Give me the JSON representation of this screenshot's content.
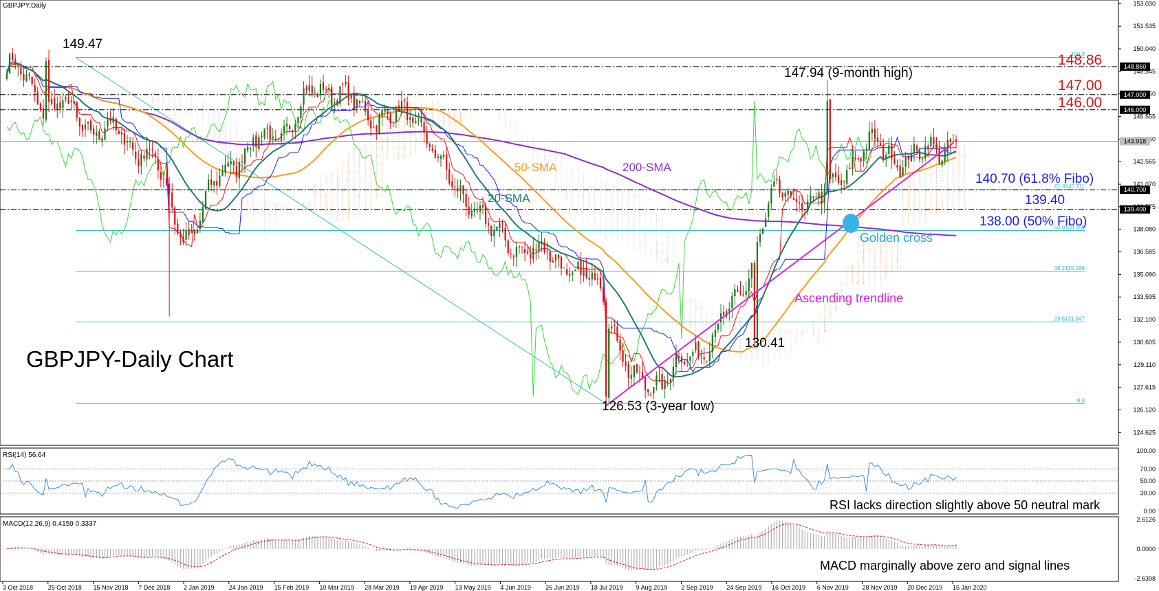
{
  "window": {
    "title": "GBPJPY,Daily"
  },
  "big_title": "GBPJPY-Daily Chart",
  "colors": {
    "bull": "#1a7a1a",
    "bear": "#e01010",
    "sma20": "#1f7a7a",
    "sma50": "#ff9a1a",
    "sma200": "#8a2bd6",
    "chikou": "#33dd33",
    "kijun": "#1a1aff",
    "tenkan": "#ff1010",
    "cloud": "#f2a06a",
    "fibo": "#33c0c0",
    "trend": "#e020e0",
    "rsi": "#3a90e8",
    "macd_signal": "#e01010"
  },
  "chart_data": [
    {
      "type": "candlestick",
      "title": "GBPJPY,Daily",
      "ylim": [
        124.0,
        153.0
      ],
      "x_ticks": [
        "3 Oct 2018",
        "25 Oct 2018",
        "15 Nov 2018",
        "7 Dec 2018",
        "2 Jan 2019",
        "24 Jan 2019",
        "15 Feb 2019",
        "10 Mar 2019",
        "28 Mar 2019",
        "19 Apr 2019",
        "13 May 2019",
        "4 Jun 2019",
        "26 Jun 2019",
        "18 Jul 2019",
        "9 Aug 2019",
        "2 Sep 2019",
        "24 Sep 2019",
        "16 Oct 2019",
        "6 Nov 2019",
        "28 Nov 2019",
        "20 Dec 2019",
        "15 Jan 2020"
      ],
      "y_ticks": [
        "153.030",
        "151.535",
        "150.040",
        "148.545",
        "147.050",
        "145.555",
        "144.060",
        "142.565",
        "141.070",
        "139.575",
        "138.080",
        "136.585",
        "135.090",
        "133.595",
        "132.100",
        "130.605",
        "129.110",
        "127.615",
        "126.120",
        "124.625"
      ],
      "price_tags": [
        {
          "label": "148.860",
          "value": 148.86,
          "style": "black"
        },
        {
          "label": "147.000",
          "value": 147.0,
          "style": "black"
        },
        {
          "label": "146.000",
          "value": 146.0,
          "style": "black"
        },
        {
          "label": "143.918",
          "value": 143.918,
          "style": "grey"
        },
        {
          "label": "140.700",
          "value": 140.7,
          "style": "black"
        },
        {
          "label": "139.400",
          "value": 139.4,
          "style": "black"
        }
      ],
      "horizontal_levels": [
        {
          "value": 148.86,
          "label": "148.86",
          "color": "#e01010"
        },
        {
          "value": 147.0,
          "label": "147.00",
          "color": "#e01010"
        },
        {
          "value": 146.0,
          "label": "146.00",
          "color": "#e01010"
        },
        {
          "value": 139.4,
          "label": "139.40",
          "color": "#1a1aff"
        }
      ],
      "fibonacci": [
        {
          "label": "100.0",
          "value": 149.47
        },
        {
          "label": "61.8",
          "value": 140.71
        },
        {
          "label": "50.0",
          "value": 138.0
        },
        {
          "label": "38.2",
          "value": 135.296
        },
        {
          "label": "23.6",
          "value": 131.947
        },
        {
          "label": "0.0",
          "value": 126.53
        }
      ],
      "fibo_tiny_labels": [
        "100.0",
        "61.8140.711",
        "50.0138.000",
        "38.2135.296",
        "23.6131.947",
        "0.0"
      ],
      "annotations": [
        {
          "text": "149.47"
        },
        {
          "text": "147.94 (9-month high)"
        },
        {
          "text": "148.86"
        },
        {
          "text": "147.00"
        },
        {
          "text": "146.00"
        },
        {
          "text": "140.70 (61.8% Fibo)"
        },
        {
          "text": "139.40"
        },
        {
          "text": "138.00 (50% Fibo)"
        },
        {
          "text": "Golden cross"
        },
        {
          "text": "50-SMA"
        },
        {
          "text": "200-SMA"
        },
        {
          "text": "20-SMA"
        },
        {
          "text": "Ascending trendline"
        },
        {
          "text": "130.41"
        },
        {
          "text": "126.53 (3-year low)"
        }
      ],
      "anchors": [
        {
          "x": "3 Oct 2018",
          "close": 148.8
        },
        {
          "x": "25 Oct 2018",
          "close": 146.3
        },
        {
          "x": "15 Nov 2018",
          "close": 144.8
        },
        {
          "x": "7 Dec 2018",
          "close": 143.5
        },
        {
          "x": "2 Jan 2019",
          "close": 137.8
        },
        {
          "x": "24 Jan 2019",
          "close": 142.8
        },
        {
          "x": "15 Feb 2019",
          "close": 144.5
        },
        {
          "x": "10 Mar 2019",
          "close": 147.6
        },
        {
          "x": "28 Mar 2019",
          "close": 145.8
        },
        {
          "x": "19 Apr 2019",
          "close": 145.4
        },
        {
          "x": "13 May 2019",
          "close": 140.5
        },
        {
          "x": "4 Jun 2019",
          "close": 137.3
        },
        {
          "x": "26 Jun 2019",
          "close": 136.3
        },
        {
          "x": "18 Jul 2019",
          "close": 134.5
        },
        {
          "x": "9 Aug 2019",
          "close": 127.6
        },
        {
          "x": "2 Sep 2019",
          "close": 129.2
        },
        {
          "x": "24 Sep 2019",
          "close": 132.5
        },
        {
          "x": "16 Oct 2019",
          "close": 140.1
        },
        {
          "x": "6 Nov 2019",
          "close": 140.1
        },
        {
          "x": "28 Nov 2019",
          "close": 143.5
        },
        {
          "x": "20 Dec 2019",
          "close": 142.8
        },
        {
          "x": "15 Jan 2020",
          "close": 143.9
        }
      ],
      "extremes": [
        {
          "label": "149.47",
          "value": 149.47
        },
        {
          "label": "147.94",
          "value": 147.94
        },
        {
          "label": "130.41",
          "value": 130.41
        },
        {
          "label": "126.53",
          "value": 126.53
        }
      ],
      "overlays": [
        "20-SMA",
        "50-SMA",
        "200-SMA",
        "Ichimoku Tenkan",
        "Ichimoku Kijun",
        "Ichimoku Chikou",
        "Ichimoku cloud"
      ]
    },
    {
      "type": "line",
      "title": "RSI(14) 56.64",
      "series": [
        {
          "name": "RSI(14)",
          "last": 56.64
        }
      ],
      "ylim": [
        0,
        100
      ],
      "y_ticks": [
        "100.00",
        "70.00",
        "50.00",
        "30.00",
        "0.00"
      ],
      "annotation": "RSI lacks direction slightly above 50 neutral mark"
    },
    {
      "type": "bar",
      "title": "MACD(12,26,9) 0.4159 0.3337",
      "series": [
        {
          "name": "MACD",
          "last": 0.4159
        },
        {
          "name": "Signal",
          "last": 0.3337
        }
      ],
      "y_ticks": [
        "2.6126",
        "0.0000",
        "-2.6398"
      ],
      "annotation": "MACD marginally above zero and signal lines"
    }
  ]
}
